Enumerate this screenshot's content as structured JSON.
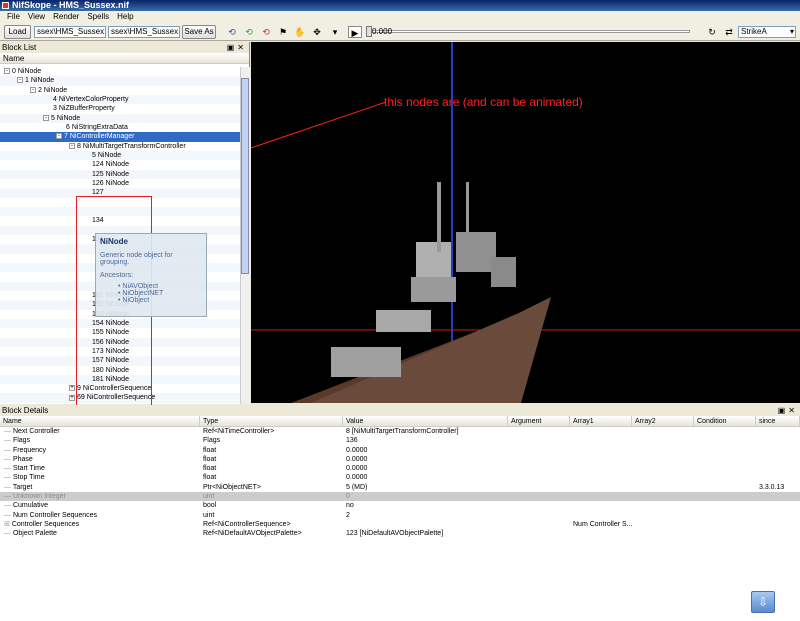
{
  "window": {
    "title": "NifSkope - HMS_Sussex.nif"
  },
  "menu": [
    "File",
    "View",
    "Render",
    "Spells",
    "Help"
  ],
  "toolbar": {
    "load": "Load",
    "path1": "ssex\\HMS_Sussex.nif",
    "path2": "ssex\\HMS_Sussex.nif",
    "save_as": "Save As",
    "time": "0.000",
    "sequence": "StrikeA",
    "time_progress": 0
  },
  "blocklist": {
    "title": "Block List",
    "header": "Name",
    "rows": [
      {
        "text": "0   NiNode",
        "depth": 0,
        "box": "-"
      },
      {
        "text": "1   NiNode",
        "depth": 1,
        "box": "-"
      },
      {
        "text": "2   NiNode",
        "depth": 2,
        "box": "-"
      },
      {
        "text": "4   NiVertexColorProperty",
        "depth": 3,
        "box": ""
      },
      {
        "text": "3   NiZBufferProperty",
        "depth": 3,
        "box": ""
      },
      {
        "text": "5   NiNode",
        "depth": 3,
        "box": "-"
      },
      {
        "text": "6   NiStringExtraData",
        "depth": 4,
        "box": ""
      },
      {
        "text": "7   NiControllerManager",
        "depth": 4,
        "box": "-",
        "sel": true
      },
      {
        "text": "8   NiMultiTargetTransformController",
        "depth": 5,
        "box": "-"
      },
      {
        "text": "5   NiNode",
        "depth": 6,
        "box": ""
      },
      {
        "text": "124 NiNode",
        "depth": 6,
        "box": ""
      },
      {
        "text": "125 NiNode",
        "depth": 6,
        "box": ""
      },
      {
        "text": "126 NiNode",
        "depth": 6,
        "box": ""
      },
      {
        "text": "127",
        "depth": 6,
        "box": ""
      },
      {
        "text": "",
        "depth": 6,
        "box": ""
      },
      {
        "text": "",
        "depth": 6,
        "box": ""
      },
      {
        "text": "134",
        "depth": 6,
        "box": ""
      },
      {
        "text": "",
        "depth": 6,
        "box": ""
      },
      {
        "text": "136",
        "depth": 6,
        "box": ""
      },
      {
        "text": "",
        "depth": 6,
        "box": ""
      },
      {
        "text": "",
        "depth": 6,
        "box": ""
      },
      {
        "text": "",
        "depth": 6,
        "box": ""
      },
      {
        "text": "",
        "depth": 6,
        "box": ""
      },
      {
        "text": "",
        "depth": 6,
        "box": ""
      },
      {
        "text": "151 NiNode",
        "depth": 6,
        "box": ""
      },
      {
        "text": "152 NiNode",
        "depth": 6,
        "box": ""
      },
      {
        "text": "153 NiNode",
        "depth": 6,
        "box": ""
      },
      {
        "text": "154 NiNode",
        "depth": 6,
        "box": ""
      },
      {
        "text": "155 NiNode",
        "depth": 6,
        "box": ""
      },
      {
        "text": "156 NiNode",
        "depth": 6,
        "box": ""
      },
      {
        "text": "173 NiNode",
        "depth": 6,
        "box": ""
      },
      {
        "text": "157 NiNode",
        "depth": 6,
        "box": ""
      },
      {
        "text": "180 NiNode",
        "depth": 6,
        "box": ""
      },
      {
        "text": "181 NiNode",
        "depth": 6,
        "box": ""
      },
      {
        "text": "9   NiControllerSequence",
        "depth": 5,
        "box": "+"
      },
      {
        "text": "69  NiControllerSequence",
        "depth": 5,
        "box": "+"
      }
    ]
  },
  "tooltip": {
    "title": "NiNode",
    "desc": "Generic node object for grouping.",
    "ancestors_label": "Ancestors:",
    "ancestors": [
      "• NiAVObject",
      "• NiObjectNET",
      "• NiObject"
    ]
  },
  "viewport": {
    "annotation": "this nodes are (and can be animated)"
  },
  "details": {
    "title": "Block Details",
    "columns": [
      "Name",
      "Type",
      "Value",
      "Argument",
      "Array1",
      "Array2",
      "Condition",
      "since"
    ],
    "rows": [
      {
        "name": "Next Controller",
        "type": "Ref<NiTimeController>",
        "value": "8 [NiMultiTargetTransformController]",
        "arg": "",
        "a1": "",
        "a2": "",
        "cond": "",
        "since": ""
      },
      {
        "name": "Flags",
        "type": "Flags",
        "value": "136",
        "arg": "",
        "a1": "",
        "a2": "",
        "cond": "",
        "since": ""
      },
      {
        "name": "Frequency",
        "type": "float",
        "value": "0.0000",
        "arg": "",
        "a1": "",
        "a2": "",
        "cond": "",
        "since": ""
      },
      {
        "name": "Phase",
        "type": "float",
        "value": "0.0000",
        "arg": "",
        "a1": "",
        "a2": "",
        "cond": "",
        "since": ""
      },
      {
        "name": "Start Time",
        "type": "float",
        "value": "0.0000",
        "arg": "",
        "a1": "",
        "a2": "",
        "cond": "",
        "since": ""
      },
      {
        "name": "Stop Time",
        "type": "float",
        "value": "0.0000",
        "arg": "",
        "a1": "",
        "a2": "",
        "cond": "",
        "since": ""
      },
      {
        "name": "Target",
        "type": "Ptr<NiObjectNET>",
        "value": "5 (MD)",
        "arg": "",
        "a1": "",
        "a2": "",
        "cond": "",
        "since": "3.3.0.13"
      },
      {
        "name": "Unknown Integer",
        "type": "uint",
        "value": "0",
        "arg": "",
        "a1": "",
        "a2": "",
        "cond": "",
        "since": "",
        "grey": true
      },
      {
        "name": "Cumulative",
        "type": "bool",
        "value": "no",
        "arg": "",
        "a1": "",
        "a2": "",
        "cond": "",
        "since": ""
      },
      {
        "name": "Num Controller Sequences",
        "type": "uint",
        "value": "2",
        "arg": "",
        "a1": "",
        "a2": "",
        "cond": "",
        "since": ""
      },
      {
        "name": "Controller Sequences",
        "type": "Ref<NiControllerSequence>",
        "value": "",
        "arg": "",
        "a1": "Num Controller S...",
        "a2": "",
        "cond": "",
        "since": "",
        "expand": true
      },
      {
        "name": "Object Palette",
        "type": "Ref<NiDefaultAVObjectPalette>",
        "value": "123 [NiDefaultAVObjectPalette]",
        "arg": "",
        "a1": "",
        "a2": "",
        "cond": "",
        "since": ""
      }
    ]
  }
}
